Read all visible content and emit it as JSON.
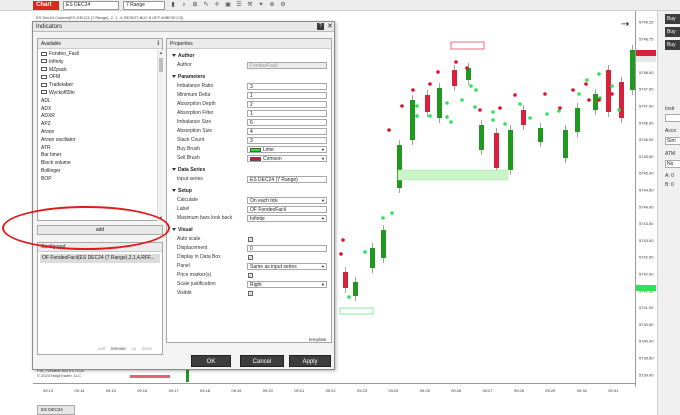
{
  "toolbar": {
    "chart_tab": "Chart",
    "instrument": "ES DEC24",
    "bar_type": "7 Range",
    "icons": [
      "bar-chart-icon",
      "magnifier-icon",
      "draw-tool-icon",
      "pencil-icon",
      "crosshair-icon",
      "screenshot-icon",
      "list-icon",
      "tool-icon",
      "sparkle-icon",
      "zoom-icon",
      "gear-icon"
    ]
  },
  "chart": {
    "title": "ES Dec24 Custom(ES DEC24 (7 Range), 2, 1, 4, RESIST-BUY 8 OFF #0BF39 CS)",
    "price_ticks": [
      "5749.25",
      "5748.75",
      "5748.50",
      "5748.00",
      "5747.50",
      "5747.00",
      "5746.50",
      "5746.00",
      "5745.50",
      "5745.00",
      "5744.50",
      "5744.00",
      "5743.50",
      "5743.00",
      "5742.50",
      "5742.00",
      "5741.50",
      "5741.00",
      "5740.50",
      "5740.00",
      "5739.50",
      "5739.00"
    ],
    "time_ticks": [
      "09:13",
      "09:14",
      "09:15",
      "09:16",
      "09:17",
      "09:18",
      "09:19",
      "09:20",
      "09:21",
      "09:22",
      "09:23",
      "09:24",
      "09:25",
      "09:26",
      "09:27",
      "09:28",
      "09:29",
      "09:30",
      "09:31"
    ],
    "copyright_line1": "FIN_FondeoFacil ES 2024",
    "copyright_line2": "© 2024 NinjaTrader, LLC",
    "bottom_tab": "ES DEC24"
  },
  "right_panel": {
    "buttons": [
      "Buy",
      "Buy",
      "Buy"
    ],
    "labels": [
      "Instr",
      "Acco",
      "ATM",
      "A:",
      "B:"
    ],
    "inputs": [
      "Sim",
      "No"
    ],
    "label_values": [
      "0",
      "0"
    ]
  },
  "dialog": {
    "title": "Indicators",
    "help": "?",
    "close": "✕",
    "available_header": "Available",
    "available_icon": "i",
    "available_items": [
      {
        "label": "Fondeo_Facil",
        "folder": true
      },
      {
        "label": "Infinity",
        "folder": true
      },
      {
        "label": "MZpack",
        "folder": true
      },
      {
        "label": "OFM",
        "folder": true
      },
      {
        "label": "Tradelaber",
        "folder": true
      },
      {
        "label": "Wyckoff2ltn",
        "folder": true
      },
      {
        "label": "ADL",
        "folder": false
      },
      {
        "label": "ADX",
        "folder": false
      },
      {
        "label": "ADXR",
        "folder": false
      },
      {
        "label": "APZ",
        "folder": false
      },
      {
        "label": "Aroon",
        "folder": false
      },
      {
        "label": "Aroon oscillator",
        "folder": false
      },
      {
        "label": "ATR",
        "folder": false
      },
      {
        "label": "Bar timer",
        "folder": false
      },
      {
        "label": "Block volume",
        "folder": false
      },
      {
        "label": "Bollinger",
        "folder": false
      },
      {
        "label": "BOP",
        "folder": false
      }
    ],
    "add_label": "add",
    "configured_header": "Configured",
    "configured_item": "OF FondeoFacil(ES DEC24 (7 Range),2,1,4,RFF...",
    "configured_actions": [
      "add",
      "remove",
      "up",
      "down"
    ],
    "properties_header": "Properties",
    "sections": {
      "author": "Author",
      "parameters": "Parameters",
      "data_series": "Data Series",
      "setup": "Setup",
      "visual": "Visual"
    },
    "author": {
      "label": "Author",
      "value": "FondeoFacil"
    },
    "parameters": [
      {
        "label": "Imbalance Ratio",
        "value": "3"
      },
      {
        "label": "Minimum Delta",
        "value": "1"
      },
      {
        "label": "Absorption Depth",
        "value": "2"
      },
      {
        "label": "Absorption Filter",
        "value": "1"
      },
      {
        "label": "Imbalance Size",
        "value": "6"
      },
      {
        "label": "Absorption Size",
        "value": "4"
      },
      {
        "label": "Stack Count",
        "value": "3"
      }
    ],
    "buy_brush": {
      "label": "Buy Brush",
      "value": "Lime",
      "color": "#32e032"
    },
    "sell_brush": {
      "label": "Sell Brush",
      "value": "Crimson",
      "color": "#dc143c"
    },
    "input_series": {
      "label": "Input series",
      "value": "ES DEC24 (7 Range)"
    },
    "setup": [
      {
        "label": "Calculate",
        "value": "On each tick"
      },
      {
        "label": "Label",
        "value": "OF FondeoFacil"
      },
      {
        "label": "Maximum bars look back",
        "value": "Infinite"
      }
    ],
    "visual": {
      "auto_scale": {
        "label": "Auto scale",
        "checked": "✓"
      },
      "displacement": {
        "label": "Displacement",
        "value": "0"
      },
      "display_in_data_box": {
        "label": "Display in Data Box",
        "checked": "✓"
      },
      "panel": {
        "label": "Panel",
        "value": "Same as input series"
      },
      "price_markers": {
        "label": "Price marker(s)",
        "checked": "✓"
      },
      "scale_justification": {
        "label": "Scale justification",
        "value": "Right"
      },
      "visible": {
        "label": "Visible",
        "checked": "✓"
      }
    },
    "template_link": "template",
    "buttons": {
      "ok": "OK",
      "cancel": "Cancel",
      "apply": "Apply"
    }
  },
  "colors": {
    "chart_tab": "#d72a1f",
    "bull_candle": "#1f9a1f",
    "bear_candle": "#d8213a",
    "buy_dot": "#2ee35a",
    "sell_dot": "#e0102a",
    "annotation": "#e01b1b"
  }
}
